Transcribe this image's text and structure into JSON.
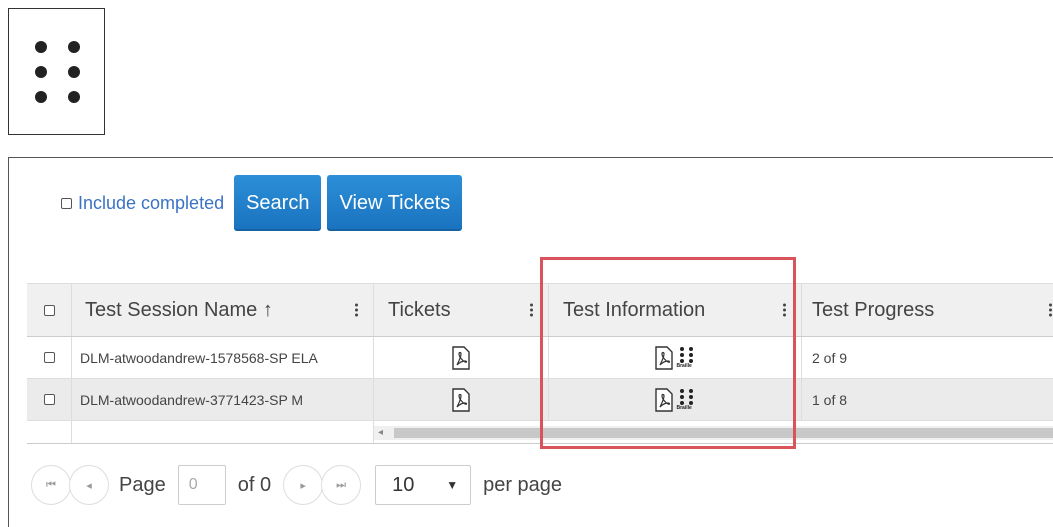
{
  "toolbar": {
    "include_completed_label": "Include completed",
    "search_label": "Search",
    "view_tickets_label": "View Tickets"
  },
  "grid": {
    "columns": [
      "Test Session Name",
      "Tickets",
      "Test Information",
      "Test Progress"
    ],
    "sort_indicator": "↑",
    "rows": [
      {
        "session": "DLM-atwoodandrew-1578568-SP ELA",
        "progress": "2 of 9"
      },
      {
        "session": "DLM-atwoodandrew-3771423-SP M",
        "progress": "1 of 8"
      }
    ]
  },
  "braille_label": "Braille",
  "pager": {
    "page_label": "Page",
    "page_value": "0",
    "of_label": "of 0",
    "per_page_value": "10",
    "per_page_label": "per page"
  },
  "colors": {
    "button": "#1a72bf",
    "link": "#3a73c5",
    "highlight": "#d9545a"
  }
}
